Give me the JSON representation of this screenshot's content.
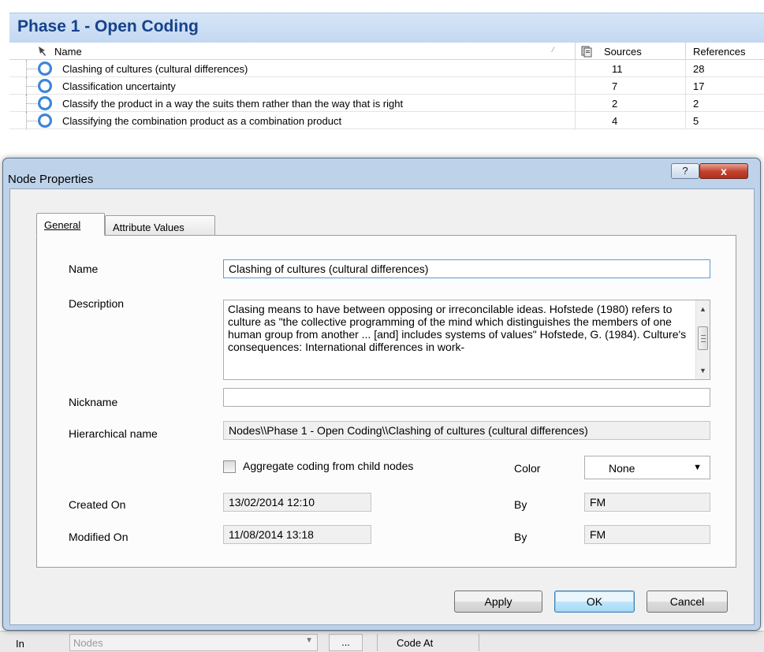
{
  "background": {
    "phase_title": "Phase 1  -  Open Coding",
    "columns": {
      "name": "Name",
      "sources": "Sources",
      "references": "References"
    },
    "rows": [
      {
        "name": "Clashing of cultures (cultural differences)",
        "sources": "11",
        "references": "28"
      },
      {
        "name": "Classification uncertainty",
        "sources": "7",
        "references": "17"
      },
      {
        "name": "Classify the product in a way the suits them rather than the way that is right",
        "sources": "2",
        "references": "2"
      },
      {
        "name": "Classifying the combination product as a combination product",
        "sources": "4",
        "references": "5"
      }
    ],
    "bottom_bar": {
      "in_label": "In",
      "scope_value": "Nodes",
      "ellipsis": "...",
      "code_at": "Code At"
    }
  },
  "dialog": {
    "title": "Node Properties",
    "help_symbol": "?",
    "close_symbol": "x",
    "tabs": {
      "general": "General",
      "attribute_values": "Attribute Values"
    },
    "labels": {
      "name": "Name",
      "description": "Description",
      "nickname": "Nickname",
      "hierarchical_name": "Hierarchical name",
      "aggregate": "Aggregate coding from child nodes",
      "color": "Color",
      "created_on": "Created On",
      "modified_on": "Modified On",
      "by": "By"
    },
    "values": {
      "name": "Clashing of cultures (cultural differences)",
      "description": "Clasing means to have between opposing or irreconcilable ideas. Hofstede (1980) refers to culture as \"the collective programming of the mind which distinguishes the members of one human group from another ... [and] includes systems of values\" Hofstede, G. (1984). Culture's consequences: International differences in work-",
      "nickname": "",
      "hierarchical_name": "Nodes\\\\Phase 1  - Open Coding\\\\Clashing of cultures (cultural differences)",
      "aggregate_checked": false,
      "color": "None",
      "created_on": "13/02/2014 12:10",
      "created_by": "FM",
      "modified_on": "11/08/2014 13:18",
      "modified_by": "FM"
    },
    "buttons": {
      "apply": "Apply",
      "ok": "OK",
      "cancel": "Cancel"
    }
  }
}
